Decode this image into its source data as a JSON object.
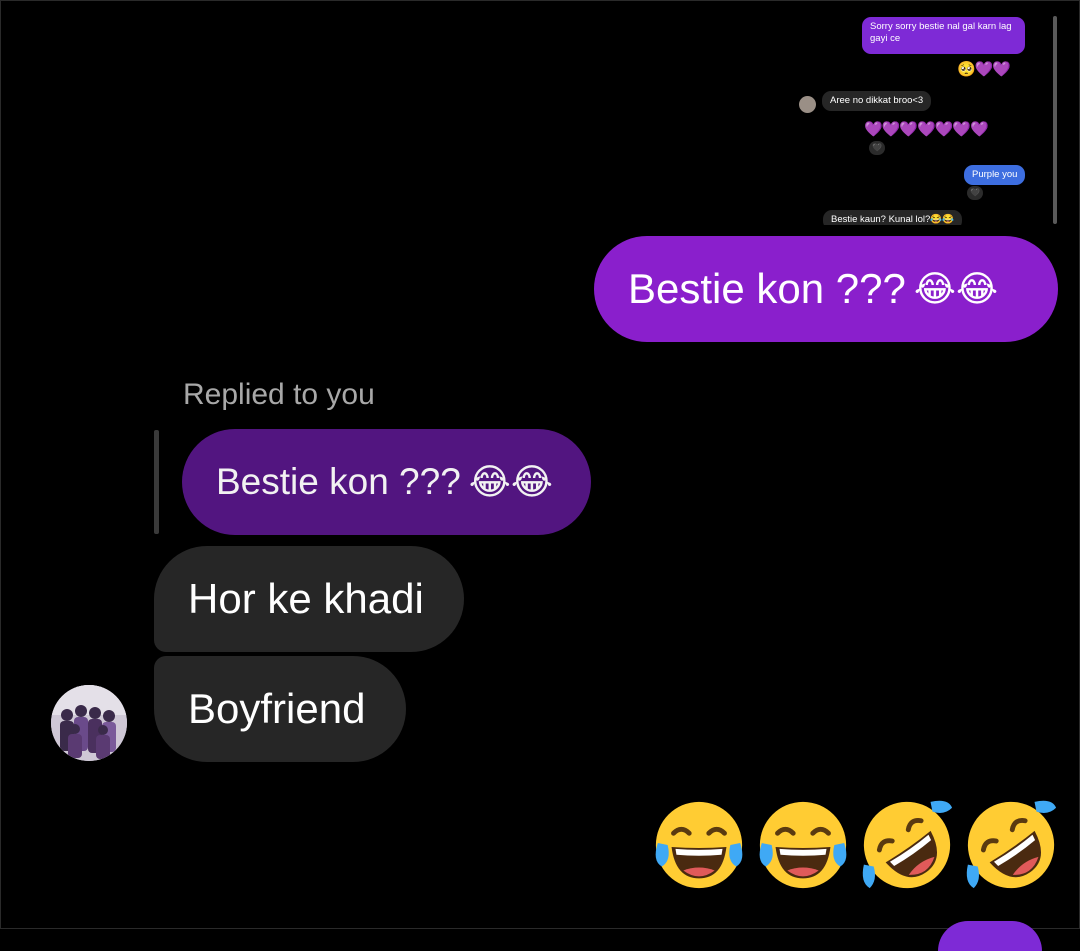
{
  "mini_thread": {
    "sent_message": "Sorry sorry bestie nal gal karn lag gayi ce",
    "emoji_row_1": "🥺💜💜",
    "received_message": "Aree no dikkat broo<3",
    "emoji_row_2": "💜💜💜💜💜💜💜",
    "reaction_1": "🖤",
    "purple_message": "Purple you",
    "reaction_2": "🖤",
    "cut_message": "Bestie kaun? Kunal lol?😂😂"
  },
  "main_thread": {
    "sent_message": "Bestie kon ???",
    "sent_emoji": "😂😂",
    "reply_label": "Replied to you",
    "quoted_message": "Bestie kon ???",
    "quoted_emoji": "😂😂",
    "received_message_1": "Hor ke khadi",
    "received_message_2": "Boyfriend",
    "big_emojis": [
      "face-with-tears-of-joy",
      "face-with-tears-of-joy",
      "rolling-on-the-floor-laughing",
      "rolling-on-the-floor-laughing"
    ]
  },
  "colors": {
    "background": "#000000",
    "sent_bubble": "#8a1fcc",
    "quoted_bubble": "#521580",
    "received_bubble": "#262626",
    "mini_sent": "#7e2ad6",
    "mini_blue": "#3d6ee0"
  }
}
